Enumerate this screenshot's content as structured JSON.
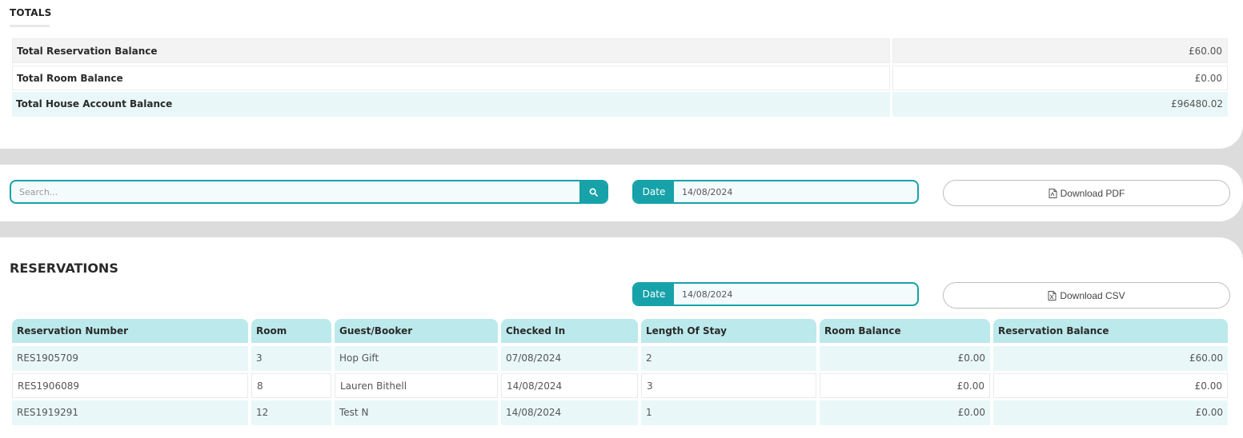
{
  "totals": {
    "title": "TOTALS",
    "rows": [
      {
        "label": "Total Reservation Balance",
        "value": "£60.00"
      },
      {
        "label": "Total Room Balance",
        "value": "£0.00"
      },
      {
        "label": "Total House Account Balance",
        "value": "£96480.02"
      }
    ]
  },
  "filters": {
    "search_placeholder": "Search...",
    "date_label": "Date",
    "date_value": "14/08/2024",
    "download_pdf_label": "Download PDF"
  },
  "reservations": {
    "title": "RESERVATIONS",
    "date_label": "Date",
    "date_value": "14/08/2024",
    "download_csv_label": "Download CSV",
    "columns": [
      "Reservation Number",
      "Room",
      "Guest/Booker",
      "Checked In",
      "Length Of Stay",
      "Room Balance",
      "Reservation Balance"
    ],
    "rows": [
      [
        "RES1905709",
        "3",
        "Hop Gift",
        "07/08/2024",
        "2",
        "£0.00",
        "£60.00"
      ],
      [
        "RES1906089",
        "8",
        "Lauren Bithell",
        "14/08/2024",
        "3",
        "£0.00",
        "£0.00"
      ],
      [
        "RES1919291",
        "12",
        "Test N",
        "14/08/2024",
        "1",
        "£0.00",
        "£0.00"
      ]
    ]
  },
  "colors": {
    "accent": "#16a2a8",
    "header_bg": "#bce9eb",
    "row_teal": "#e9f7f8",
    "row_grey": "#f3f3f3"
  }
}
